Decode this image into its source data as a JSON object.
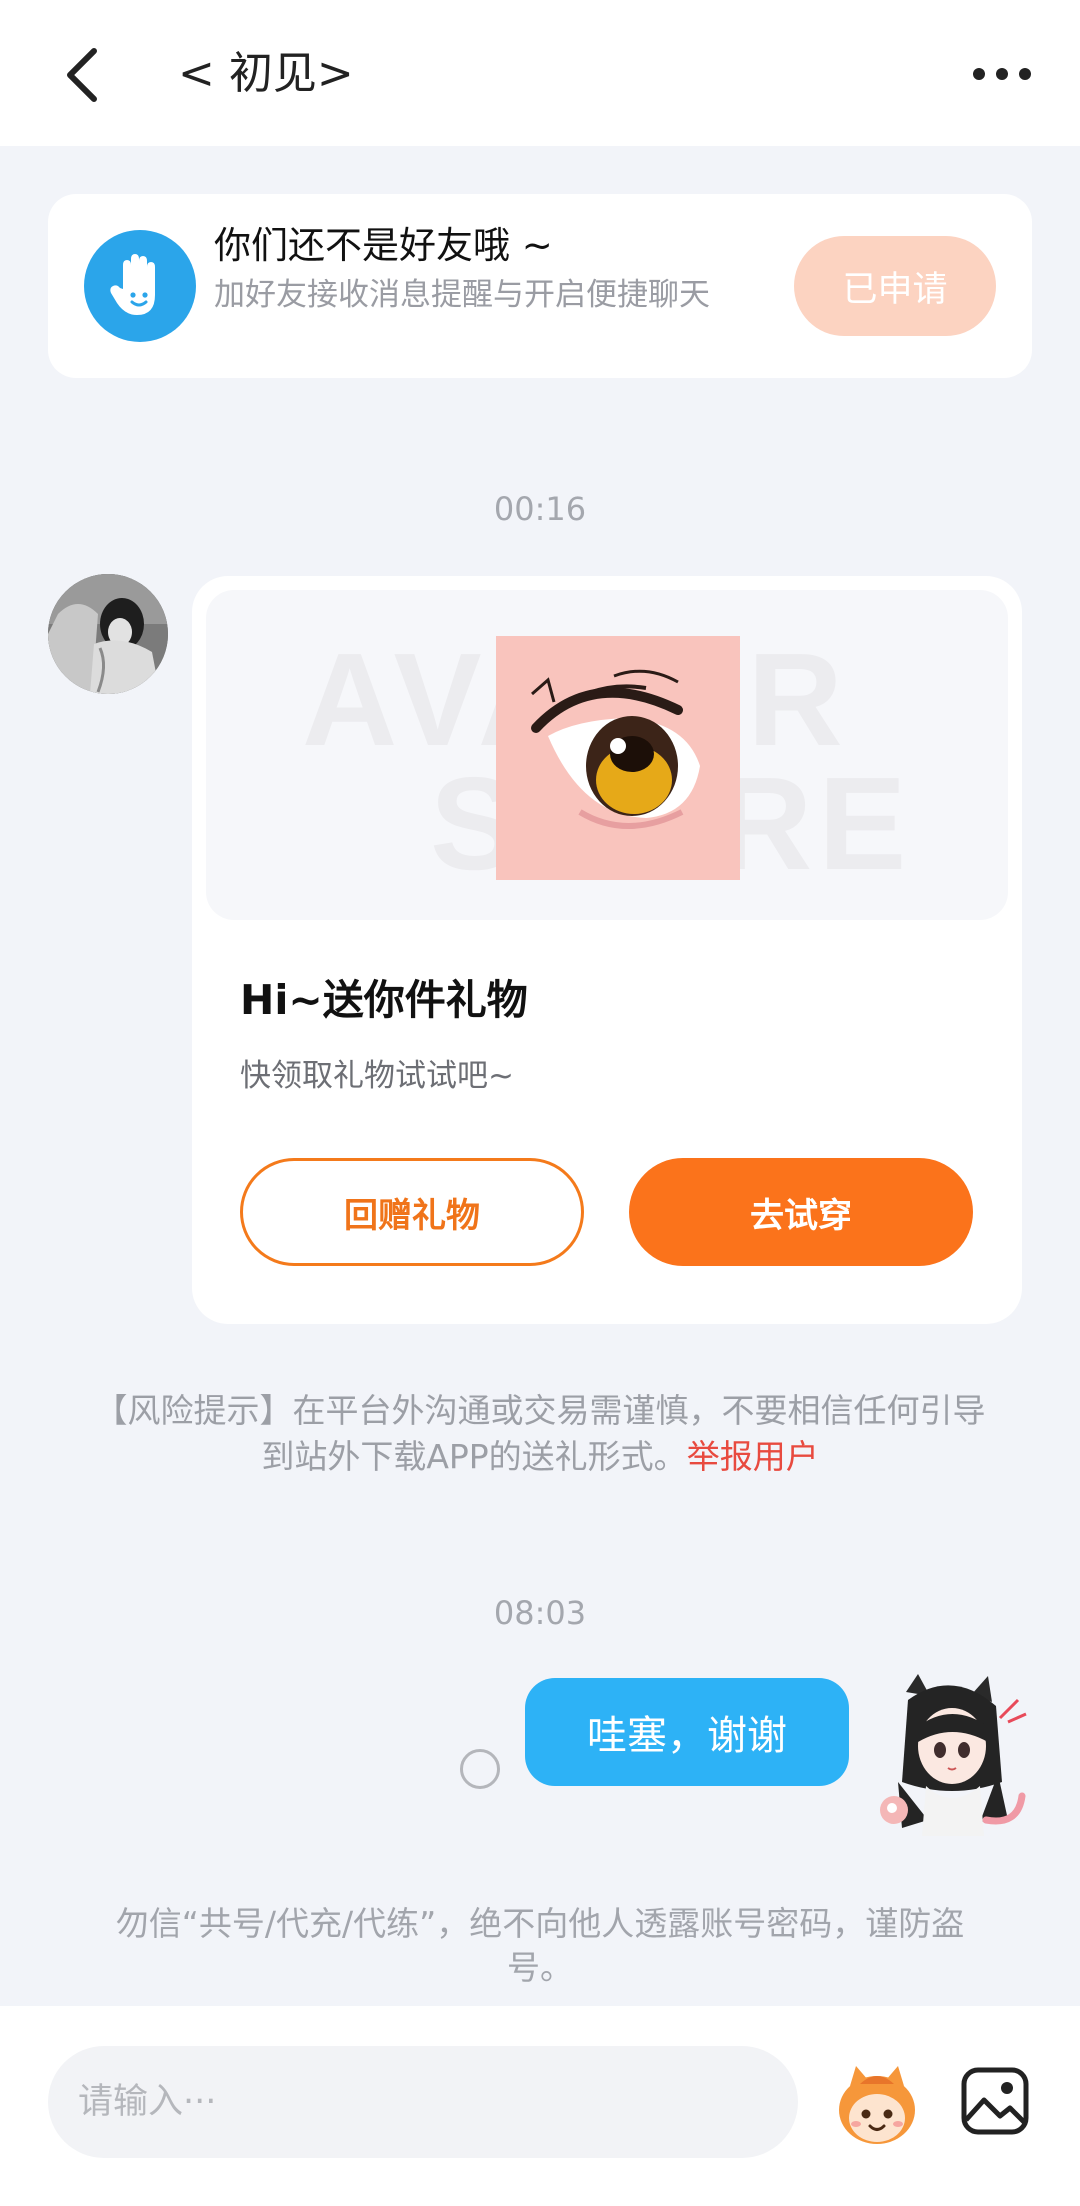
{
  "header": {
    "back_icon": "chevron-left-icon",
    "title": "< 初见>",
    "more_icon": "more-horizontal-icon"
  },
  "friend_banner": {
    "icon": "wave-hand-icon",
    "title": "你们还不是好友哦 ~",
    "subtitle": "加好友接收消息提醒与开启便捷聊天",
    "button_label": "已申请"
  },
  "messages": [
    {
      "time": "00:16",
      "type": "gift",
      "title": "Hi~送你件礼物",
      "subtitle": "快领取礼物试试吧~",
      "return_label": "回赠礼物",
      "try_label": "去试穿"
    },
    {
      "time": "08:03",
      "type": "text",
      "text": "哇塞，谢谢"
    }
  ],
  "risk_notice": {
    "text": "【风险提示】在平台外沟通或交易需谨慎，不要相信任何引导到站外下载APP的送礼形式。",
    "link": "举报用户"
  },
  "safety_notice": "勿信“共号/代充/代练”，绝不向他人透露账号密码，谨防盗号。",
  "composer": {
    "placeholder": "请输入···",
    "emoji_icon": "emoji-mascot-icon",
    "image_icon": "image-icon"
  },
  "colors": {
    "accent_orange": "#fb731b",
    "bubble_blue": "#2db2f6",
    "link_red": "#e84a3f",
    "background": "#f2f4f9"
  }
}
